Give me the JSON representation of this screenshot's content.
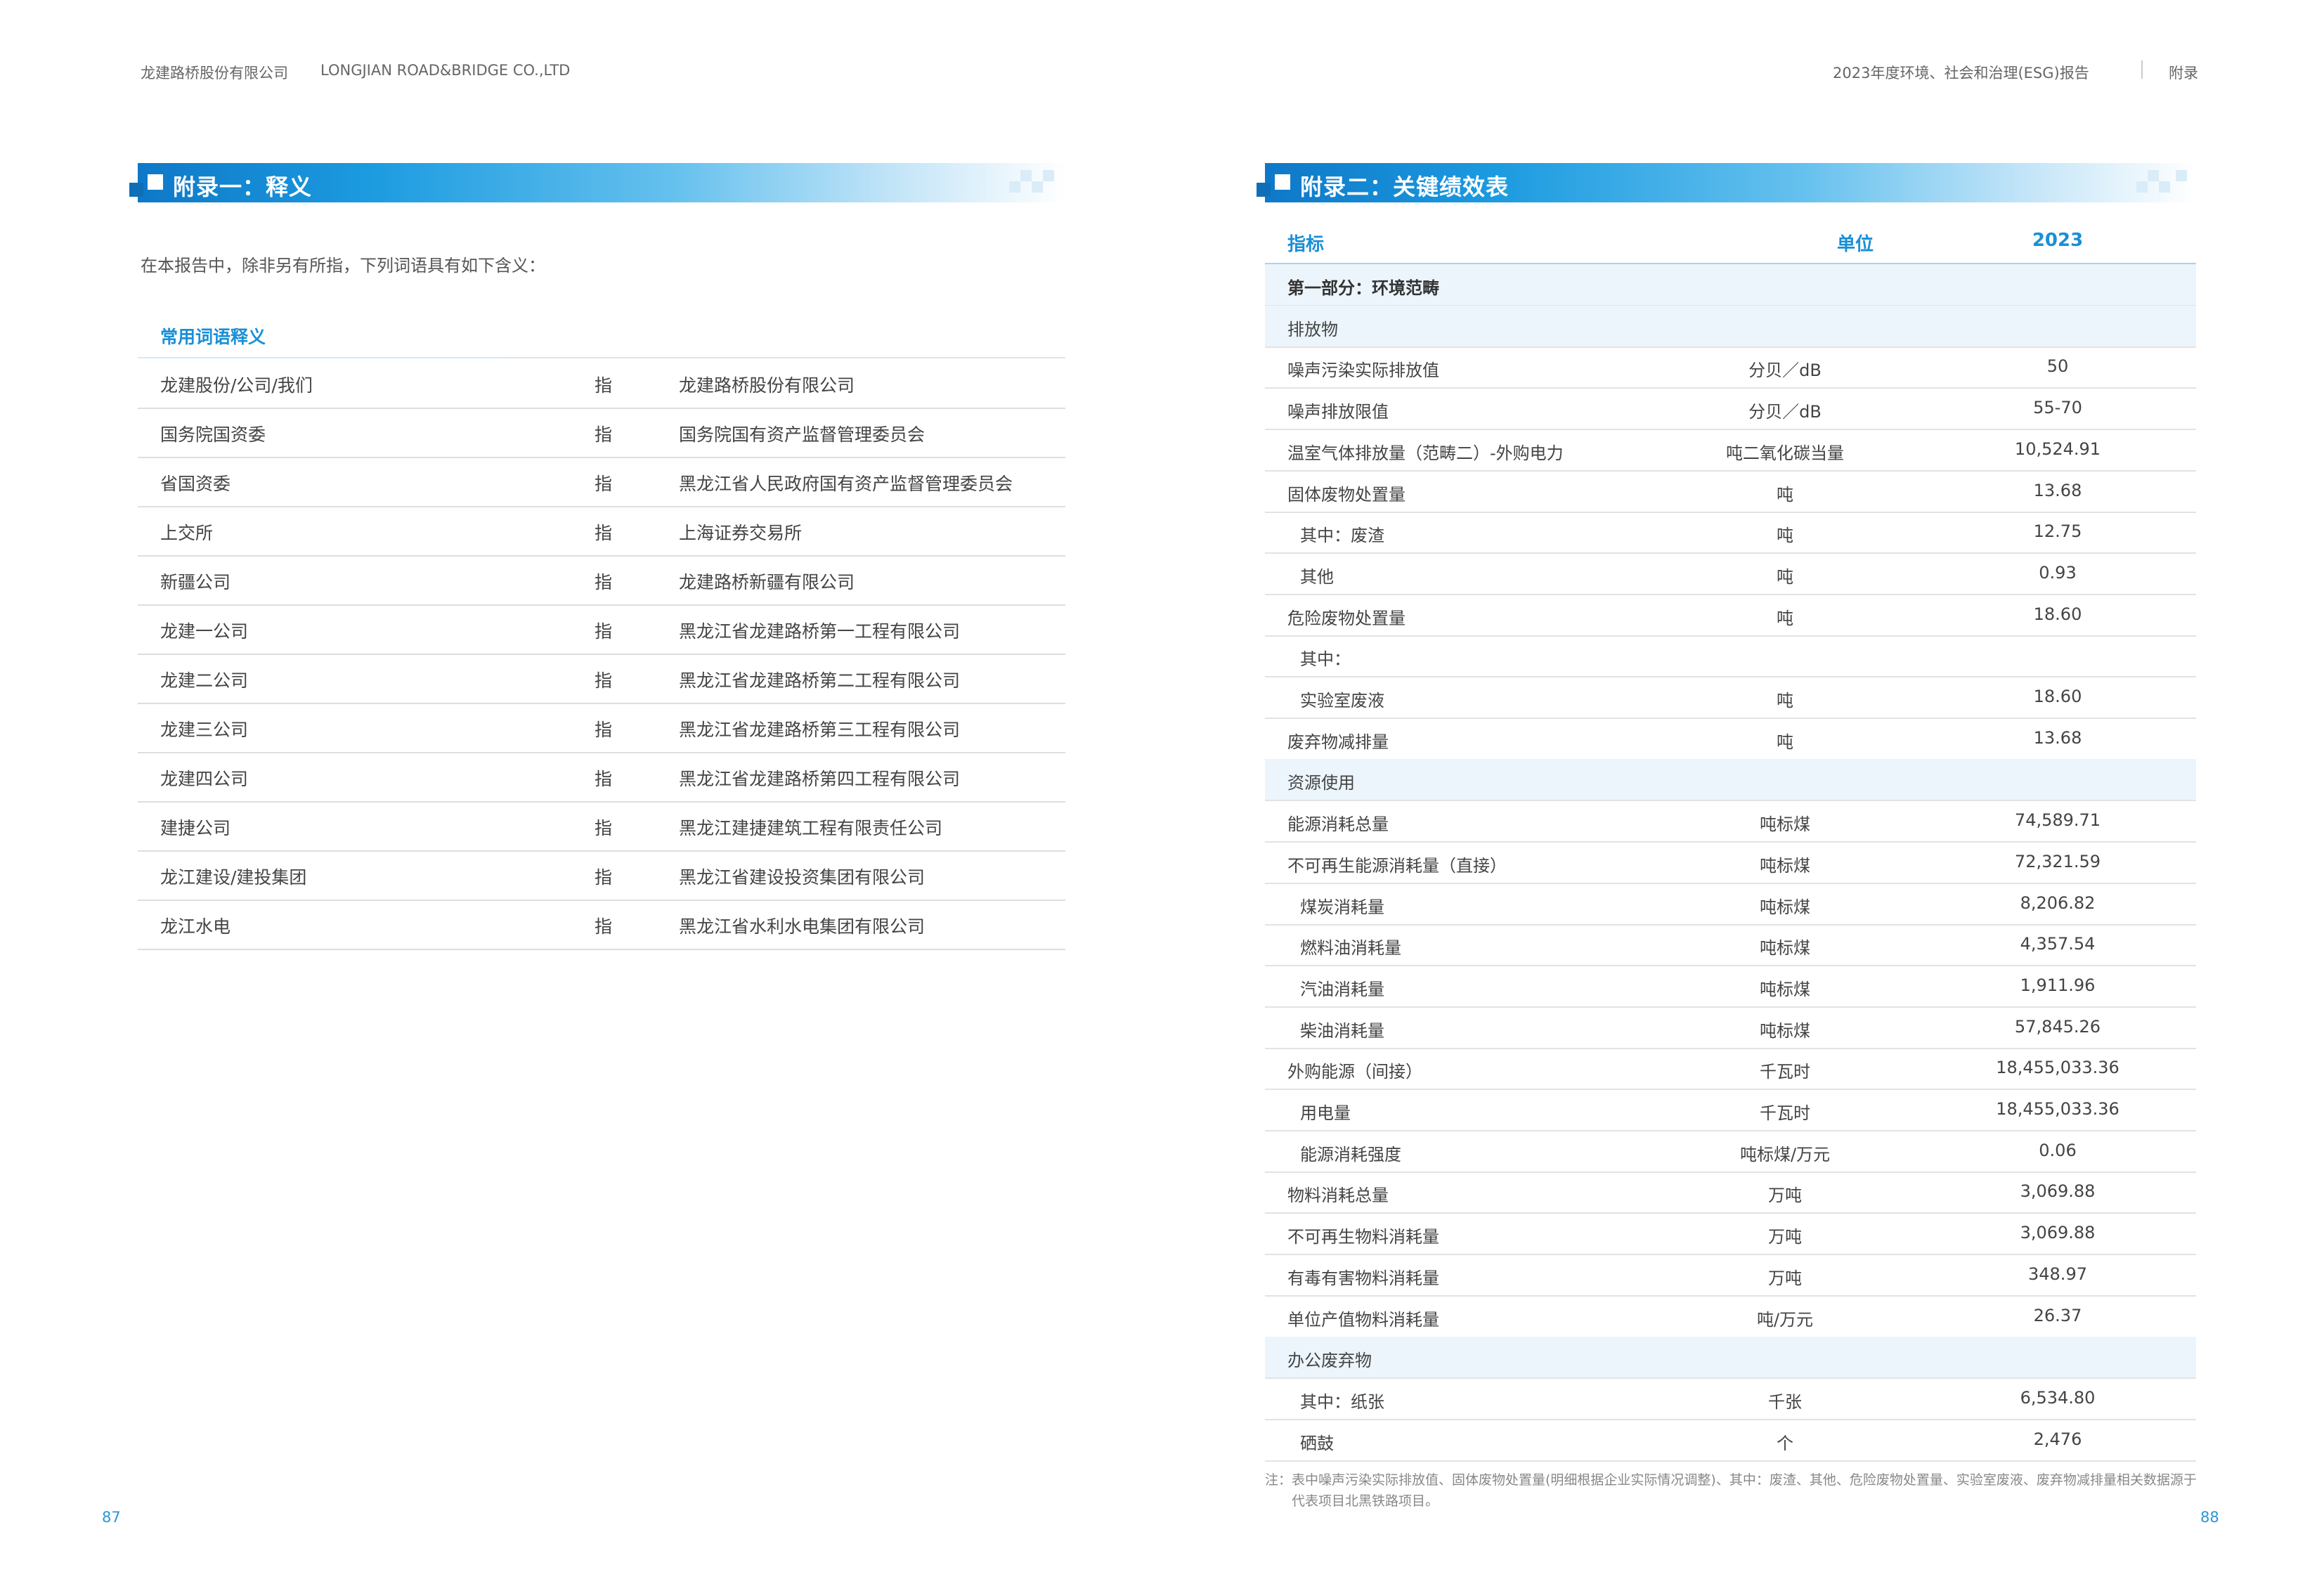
{
  "header": {
    "left_company": "龙建路桥股份有限公司",
    "left_company_en": "LONGJIAN ROAD&BRIDGE CO.,LTD",
    "right_report": "2023年度环境、社会和治理(ESG)报告",
    "right_section": "附录"
  },
  "appendix1": {
    "title": "附录一：释义",
    "intro": "在本报告中，除非另有所指，下列词语具有如下含义：",
    "table_header": "常用词语释义",
    "rows": [
      {
        "term": "龙建股份/公司/我们",
        "refers": "指",
        "meaning": "龙建路桥股份有限公司"
      },
      {
        "term": "国务院国资委",
        "refers": "指",
        "meaning": "国务院国有资产监督管理委员会"
      },
      {
        "term": "省国资委",
        "refers": "指",
        "meaning": "黑龙江省人民政府国有资产监督管理委员会"
      },
      {
        "term": "上交所",
        "refers": "指",
        "meaning": "上海证券交易所"
      },
      {
        "term": "新疆公司",
        "refers": "指",
        "meaning": "龙建路桥新疆有限公司"
      },
      {
        "term": "龙建一公司",
        "refers": "指",
        "meaning": "黑龙江省龙建路桥第一工程有限公司"
      },
      {
        "term": "龙建二公司",
        "refers": "指",
        "meaning": "黑龙江省龙建路桥第二工程有限公司"
      },
      {
        "term": "龙建三公司",
        "refers": "指",
        "meaning": "黑龙江省龙建路桥第三工程有限公司"
      },
      {
        "term": "龙建四公司",
        "refers": "指",
        "meaning": "黑龙江省龙建路桥第四工程有限公司"
      },
      {
        "term": "建捷公司",
        "refers": "指",
        "meaning": "黑龙江建捷建筑工程有限责任公司"
      },
      {
        "term": "龙江建设/建投集团",
        "refers": "指",
        "meaning": "黑龙江省建设投资集团有限公司"
      },
      {
        "term": "龙江水电",
        "refers": "指",
        "meaning": "黑龙江省水利水电集团有限公司"
      }
    ]
  },
  "appendix2": {
    "title": "附录二：关键绩效表",
    "columns": {
      "indicator": "指标",
      "unit": "单位",
      "year": "2023"
    },
    "rows": [
      {
        "indicator": "第一部分：环境范畴",
        "unit": "",
        "value": "",
        "kind": "part"
      },
      {
        "indicator": "排放物",
        "unit": "",
        "value": "",
        "kind": "section"
      },
      {
        "indicator": "噪声污染实际排放值",
        "unit": "分贝／dB",
        "value": "50",
        "kind": "row"
      },
      {
        "indicator": "噪声排放限值",
        "unit": "分贝／dB",
        "value": "55-70",
        "kind": "row"
      },
      {
        "indicator": "温室气体排放量（范畴二）-外购电力",
        "unit": "吨二氧化碳当量",
        "value": "10,524.91",
        "kind": "row"
      },
      {
        "indicator": "固体废物处置量",
        "unit": "吨",
        "value": "13.68",
        "kind": "row"
      },
      {
        "indicator": "其中：废渣",
        "unit": "吨",
        "value": "12.75",
        "kind": "sub"
      },
      {
        "indicator": "其他",
        "unit": "吨",
        "value": "0.93",
        "kind": "sub"
      },
      {
        "indicator": "危险废物处置量",
        "unit": "吨",
        "value": "18.60",
        "kind": "row"
      },
      {
        "indicator": "其中：",
        "unit": "",
        "value": "",
        "kind": "sub"
      },
      {
        "indicator": "实验室废液",
        "unit": "吨",
        "value": "18.60",
        "kind": "sub"
      },
      {
        "indicator": "废弃物减排量",
        "unit": "吨",
        "value": "13.68",
        "kind": "row"
      },
      {
        "indicator": "资源使用",
        "unit": "",
        "value": "",
        "kind": "section"
      },
      {
        "indicator": "能源消耗总量",
        "unit": "吨标煤",
        "value": "74,589.71",
        "kind": "row"
      },
      {
        "indicator": "不可再生能源消耗量（直接）",
        "unit": "吨标煤",
        "value": "72,321.59",
        "kind": "row"
      },
      {
        "indicator": "煤炭消耗量",
        "unit": "吨标煤",
        "value": "8,206.82",
        "kind": "sub"
      },
      {
        "indicator": "燃料油消耗量",
        "unit": "吨标煤",
        "value": "4,357.54",
        "kind": "sub"
      },
      {
        "indicator": "汽油消耗量",
        "unit": "吨标煤",
        "value": "1,911.96",
        "kind": "sub"
      },
      {
        "indicator": "柴油消耗量",
        "unit": "吨标煤",
        "value": "57,845.26",
        "kind": "sub"
      },
      {
        "indicator": "外购能源（间接）",
        "unit": "千瓦时",
        "value": "18,455,033.36",
        "kind": "row"
      },
      {
        "indicator": "用电量",
        "unit": "千瓦时",
        "value": "18,455,033.36",
        "kind": "sub"
      },
      {
        "indicator": "能源消耗强度",
        "unit": "吨标煤/万元",
        "value": "0.06",
        "kind": "sub"
      },
      {
        "indicator": "物料消耗总量",
        "unit": "万吨",
        "value": "3,069.88",
        "kind": "row"
      },
      {
        "indicator": "不可再生物料消耗量",
        "unit": "万吨",
        "value": "3,069.88",
        "kind": "row"
      },
      {
        "indicator": "有毒有害物料消耗量",
        "unit": "万吨",
        "value": "348.97",
        "kind": "row"
      },
      {
        "indicator": "单位产值物料消耗量",
        "unit": "吨/万元",
        "value": "26.37",
        "kind": "row"
      },
      {
        "indicator": "办公废弃物",
        "unit": "",
        "value": "",
        "kind": "section"
      },
      {
        "indicator": "其中：纸张",
        "unit": "千张",
        "value": "6,534.80",
        "kind": "sub"
      },
      {
        "indicator": "硒鼓",
        "unit": "个",
        "value": "2,476",
        "kind": "sub"
      }
    ],
    "note_line1": "注：表中噪声污染实际排放值、固体废物处置量(明细根据企业实际情况调整)、其中：废渣、其他、危险废物处置量、实验室废液、废弃物减排量相关数据源于",
    "note_line2": "代表项目北黑铁路项目。"
  },
  "page_numbers": {
    "left": "87",
    "right": "88"
  },
  "colors": {
    "accent": "#1a8fd6",
    "banner_dark": "#0e78c8",
    "section_bg": "#ecf5fc"
  }
}
